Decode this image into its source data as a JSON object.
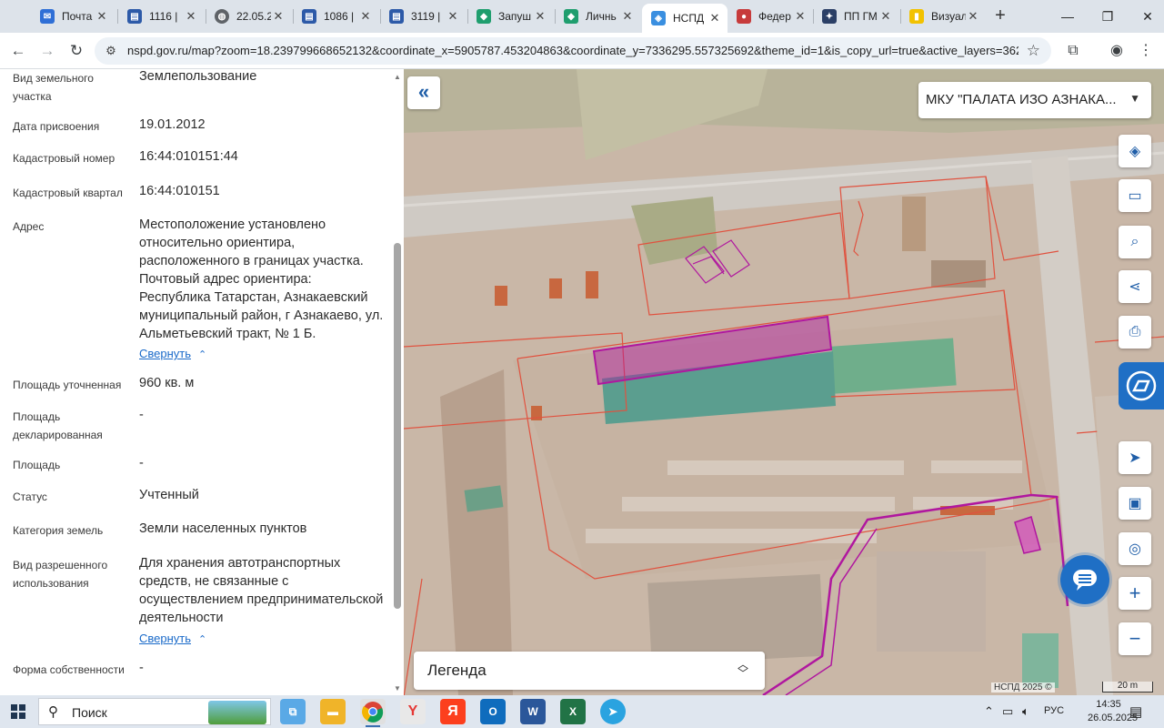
{
  "browser": {
    "tabs": [
      {
        "title": "Почта",
        "icon": "mail-icon"
      },
      {
        "title": "1116 |",
        "icon": "document-icon"
      },
      {
        "title": "22.05.2",
        "icon": "globe-icon"
      },
      {
        "title": "1086 |",
        "icon": "document-icon"
      },
      {
        "title": "3119 |",
        "icon": "document-icon"
      },
      {
        "title": "Запуш",
        "icon": "gosuslugi-icon"
      },
      {
        "title": "Личнь",
        "icon": "gosuslugi-icon"
      },
      {
        "title": "НСПД",
        "icon": "nspd-icon",
        "active": true
      },
      {
        "title": "Федер",
        "icon": "federal-icon"
      },
      {
        "title": "ПП ГМ",
        "icon": "emblem-icon"
      },
      {
        "title": "Визуал",
        "icon": "chart-icon"
      }
    ],
    "url": "nspd.gov.ru/map?zoom=18.239799668652132&coordinate_x=5905787.453204863&coordinate_y=7336295.557325692&theme_id=1&is_copy_url=true&active_layers=36281%2..."
  },
  "panel": {
    "fields": [
      {
        "label": "Вид земельного участка",
        "value": "Землепользование"
      },
      {
        "label": "Дата присвоения",
        "value": "19.01.2012"
      },
      {
        "label": "Кадастровый номер",
        "value": "16:44:010151:44"
      },
      {
        "label": "Кадастровый квартал",
        "value": "16:44:010151"
      },
      {
        "label": "Адрес",
        "value": "Местоположение установлено относительно ориентира, расположенного в границах участка. Почтовый адрес ориентира: Республика Татарстан, Азнакаевский муниципальный район, г Азнакаево, ул. Альметьевский тракт, № 1 Б."
      },
      {
        "label": "Площадь уточненная",
        "value": "960 кв. м"
      },
      {
        "label": "Площадь декларированная",
        "value": "-"
      },
      {
        "label": "Площадь",
        "value": "-"
      },
      {
        "label": "Статус",
        "value": "Учтенный"
      },
      {
        "label": "Категория земель",
        "value": "Земли населенных пунктов"
      },
      {
        "label": "Вид разрешенного использования",
        "value": "Для хранения автотранспортных средств, не связанные с осуществлением предпринимательской деятельности"
      },
      {
        "label": "Форма собственности",
        "value": "-"
      }
    ],
    "collapse_label": "Свернуть"
  },
  "map": {
    "org_selector": "МКУ \"ПАЛАТА ИЗО АЗНАКА...",
    "legend_label": "Легенда",
    "copyright": "НСПД 2025 ©",
    "scale": "20 m",
    "tools": [
      "layers-icon",
      "ruler-icon",
      "search-area-icon",
      "share-icon",
      "print-icon",
      "gosuslugi-feedback-icon",
      "locate-icon",
      "picture-in-picture-icon",
      "geo-search-icon",
      "zoom-in-icon",
      "zoom-out-icon"
    ]
  },
  "taskbar": {
    "search_label": "Поиск",
    "language": "РУС",
    "time": "14:35",
    "date": "26.05.2025"
  },
  "colors": {
    "selected_parcel": "#b0179f",
    "parcel_border": "#e0523f",
    "accent": "#1f6fc5"
  }
}
